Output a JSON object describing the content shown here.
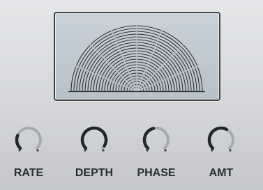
{
  "display": {
    "icon": "concentric-semicircle-waveform"
  },
  "knobs": [
    {
      "label": "RATE",
      "value": 0.25
    },
    {
      "label": "DEPTH",
      "value": 0.95
    },
    {
      "label": "PHASE",
      "value": 0.45
    },
    {
      "label": "AMT",
      "value": 0.6
    }
  ],
  "colors": {
    "knob_active": "#23272a",
    "knob_track": "#a8abae",
    "display_lines": "#2d3134",
    "label": "#2b2e31"
  }
}
